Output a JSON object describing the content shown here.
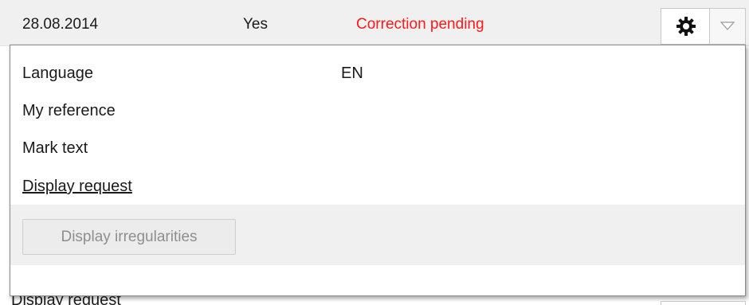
{
  "row": {
    "date": "28.08.2014",
    "flag": "Yes",
    "status": "Correction pending",
    "status_color": "#ff1a1a",
    "gear_icon": "gear-icon",
    "dropdown_icon": "chevron-down-icon"
  },
  "details": {
    "language_label": "Language",
    "language_value": "EN",
    "reference_label": "My reference",
    "mark_label": "Mark text",
    "display_request_link": "Display request"
  },
  "actions": {
    "irregularities_button": "Display irregularities"
  },
  "behind": {
    "partial_text": "Display request"
  }
}
